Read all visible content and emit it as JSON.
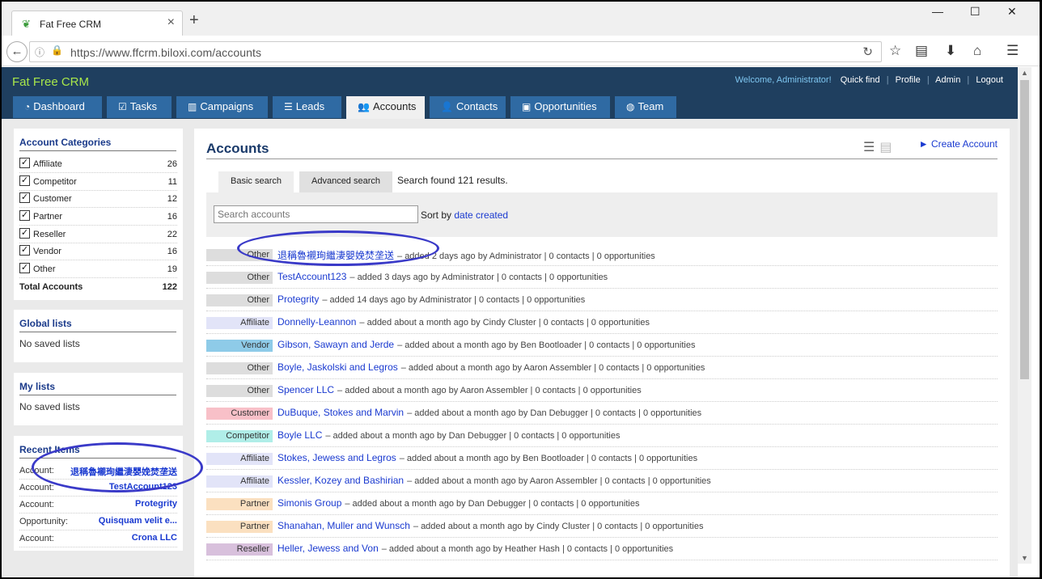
{
  "browser": {
    "tab_title": "Fat Free CRM",
    "new_tab": "+",
    "url": "https://www.ffcrm.biloxi.com/accounts",
    "win_min": "—",
    "win_max": "☐",
    "win_close": "✕"
  },
  "app": {
    "logo": "Fat Free CRM",
    "welcome": "Welcome, Administrator!",
    "menu": [
      "Quick find",
      "Profile",
      "Admin",
      "Logout"
    ],
    "tabs": [
      {
        "label": "Dashboard",
        "icon": "dashboard-icon",
        "glyph": "◔"
      },
      {
        "label": "Tasks",
        "icon": "checkbox-icon",
        "glyph": "☑"
      },
      {
        "label": "Campaigns",
        "icon": "bar-chart-icon",
        "glyph": "▥"
      },
      {
        "label": "Leads",
        "icon": "list-icon",
        "glyph": "☰"
      },
      {
        "label": "Accounts",
        "icon": "users-icon",
        "glyph": "👥"
      },
      {
        "label": "Contacts",
        "icon": "user-icon",
        "glyph": "👤"
      },
      {
        "label": "Opportunities",
        "icon": "money-icon",
        "glyph": "▣"
      },
      {
        "label": "Team",
        "icon": "globe-icon",
        "glyph": "◍"
      }
    ]
  },
  "sidebar": {
    "categories_title": "Account Categories",
    "categories": [
      {
        "label": "Affiliate",
        "count": "26"
      },
      {
        "label": "Competitor",
        "count": "11"
      },
      {
        "label": "Customer",
        "count": "12"
      },
      {
        "label": "Partner",
        "count": "16"
      },
      {
        "label": "Reseller",
        "count": "22"
      },
      {
        "label": "Vendor",
        "count": "16"
      },
      {
        "label": "Other",
        "count": "19"
      }
    ],
    "total_label": "Total Accounts",
    "total_count": "122",
    "global_title": "Global lists",
    "global_empty": "No saved lists",
    "my_title": "My lists",
    "my_empty": "No saved lists",
    "recent_title": "Recent Items",
    "recent": [
      {
        "type": "Account:",
        "name": "退稱魯襯珣繼淒嬰娩焚垄送"
      },
      {
        "type": "Account:",
        "name": "TestAccount123"
      },
      {
        "type": "Account:",
        "name": "Protegrity"
      },
      {
        "type": "Opportunity:",
        "name": "Quisquam velit e..."
      },
      {
        "type": "Account:",
        "name": "Crona LLC"
      }
    ]
  },
  "main": {
    "title": "Accounts",
    "create_link": "► Create Account",
    "basic_search": "Basic search",
    "advanced_search": "Advanced search",
    "result_count": "Search found 121 results.",
    "search_placeholder": "Search accounts",
    "sort_label": "Sort by",
    "sort_value": "date created",
    "accounts": [
      {
        "category": "Other",
        "color": "#dddddd",
        "name": "退稱魯襯珣繼淒嬰娩焚垄送",
        "meta": "– added 2 days ago by Administrator | 0 contacts | 0 opportunities"
      },
      {
        "category": "Other",
        "color": "#dddddd",
        "name": "TestAccount123",
        "meta": "– added 3 days ago by Administrator | 0 contacts | 0 opportunities"
      },
      {
        "category": "Other",
        "color": "#dddddd",
        "name": "Protegrity",
        "meta": "– added 14 days ago by Administrator | 0 contacts | 0 opportunities"
      },
      {
        "category": "Affiliate",
        "color": "#e2e4f8",
        "name": "Donnelly-Leannon",
        "meta": "– added about a month ago by Cindy Cluster | 0 contacts | 0 opportunities"
      },
      {
        "category": "Vendor",
        "color": "#8ecbe8",
        "name": "Gibson, Sawayn and Jerde",
        "meta": "– added about a month ago by Ben Bootloader | 0 contacts | 0 opportunities"
      },
      {
        "category": "Other",
        "color": "#dddddd",
        "name": "Boyle, Jaskolski and Legros",
        "meta": "– added about a month ago by Aaron Assembler | 0 contacts | 0 opportunities"
      },
      {
        "category": "Other",
        "color": "#dddddd",
        "name": "Spencer LLC",
        "meta": "– added about a month ago by Aaron Assembler | 0 contacts | 0 opportunities"
      },
      {
        "category": "Customer",
        "color": "#f8c0c8",
        "name": "DuBuque, Stokes and Marvin",
        "meta": "– added about a month ago by Dan Debugger | 0 contacts | 0 opportunities"
      },
      {
        "category": "Competitor",
        "color": "#b0eee8",
        "name": "Boyle LLC",
        "meta": "– added about a month ago by Dan Debugger | 0 contacts | 0 opportunities"
      },
      {
        "category": "Affiliate",
        "color": "#e2e4f8",
        "name": "Stokes, Jewess and Legros",
        "meta": "– added about a month ago by Ben Bootloader | 0 contacts | 0 opportunities"
      },
      {
        "category": "Affiliate",
        "color": "#e2e4f8",
        "name": "Kessler, Kozey and Bashirian",
        "meta": "– added about a month ago by Aaron Assembler | 0 contacts | 0 opportunities"
      },
      {
        "category": "Partner",
        "color": "#fbe0c0",
        "name": "Simonis Group",
        "meta": "– added about a month ago by Dan Debugger | 0 contacts | 0 opportunities"
      },
      {
        "category": "Partner",
        "color": "#fbe0c0",
        "name": "Shanahan, Muller and Wunsch",
        "meta": "– added about a month ago by Cindy Cluster | 0 contacts | 0 opportunities"
      },
      {
        "category": "Reseller",
        "color": "#d8c0dc",
        "name": "Heller, Jewess and Von",
        "meta": "– added about a month ago by Heather Hash | 0 contacts | 0 opportunities"
      }
    ]
  },
  "colors": {
    "header_bg": "#1f3f5f",
    "nav_tab": "#2f6aa3",
    "logo": "#a8e64a",
    "link": "#1a3ad0",
    "annotation": "#3a3ac8"
  }
}
